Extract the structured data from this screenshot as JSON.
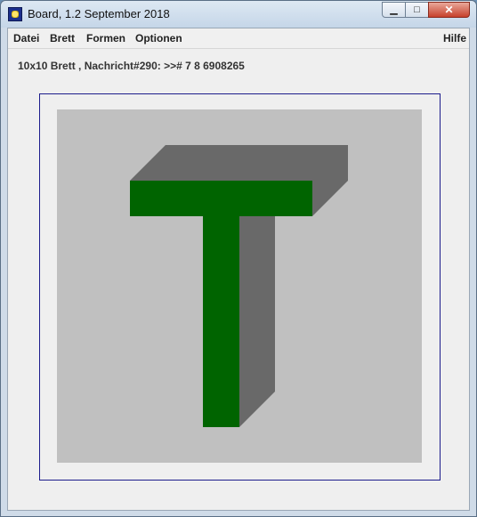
{
  "window": {
    "title": "Board, 1.2 September 2018"
  },
  "menubar": {
    "items": [
      "Datei",
      "Brett",
      "Formen",
      "Optionen"
    ],
    "help": "Hilfe"
  },
  "status": {
    "text": "10x10 Brett , Nachricht#290: >># 7 8 6908265"
  },
  "colors": {
    "board": "#c0c0c0",
    "t_face": "#006400",
    "t_side": "#696969",
    "frame": "#1c1c8c"
  }
}
